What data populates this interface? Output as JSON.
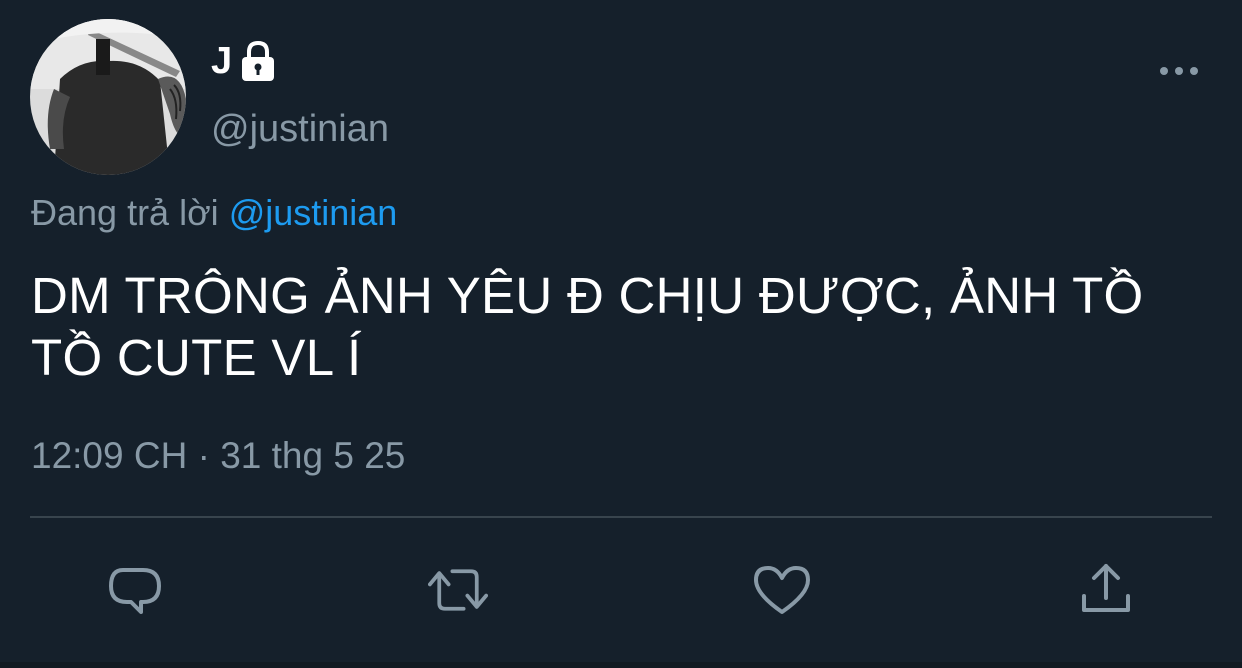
{
  "user": {
    "display_name": "J",
    "handle": "@justinian",
    "protected_icon": "lock-icon",
    "avatar": "profile-photo"
  },
  "reply_context": {
    "prefix": "Đang trả lời",
    "mention": "@justinian"
  },
  "tweet": {
    "text": "DM TRÔNG ẢNH YÊU Đ CHỊU ĐƯỢC, ẢNH TỒ TỒ CUTE VL Í",
    "timestamp": "12:09 CH · 31 thg 5 25"
  },
  "actions": [
    {
      "name": "reply",
      "icon": "comment-icon"
    },
    {
      "name": "retweet",
      "icon": "retweet-icon"
    },
    {
      "name": "like",
      "icon": "heart-icon"
    },
    {
      "name": "share",
      "icon": "share-icon"
    }
  ],
  "menu_icon": "more-dots-icon",
  "colors": {
    "background": "#15202b",
    "primary_text": "#ffffff",
    "secondary_text": "#8899a6",
    "link": "#1d9bf0",
    "divider": "#38444d"
  }
}
